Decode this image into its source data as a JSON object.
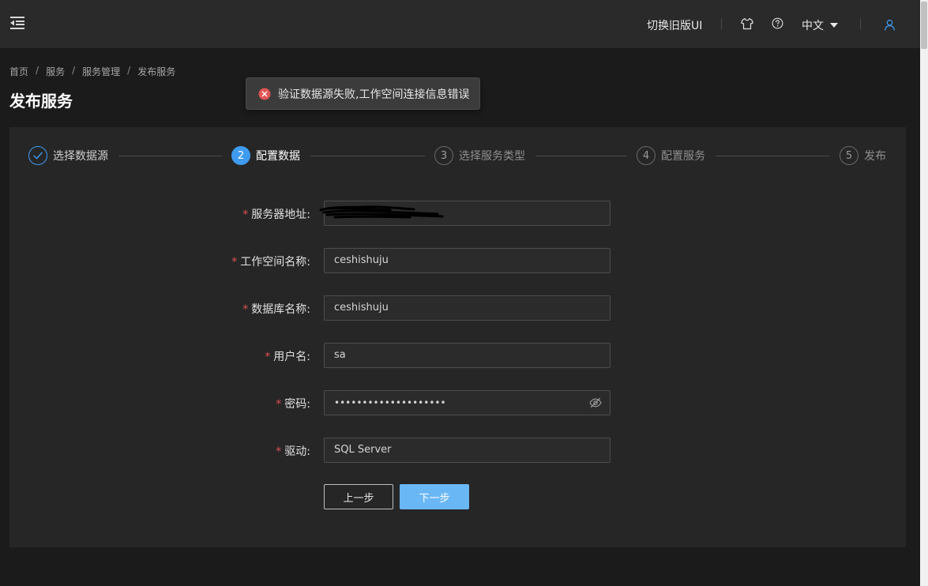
{
  "header": {
    "switch_ui_label": "切换旧版UI",
    "language_label": "中文",
    "icons": [
      "menu-fold-icon",
      "tshirt-icon",
      "help-icon",
      "user-icon"
    ]
  },
  "breadcrumb": {
    "items": [
      "首页",
      "服务",
      "服务管理",
      "发布服务"
    ],
    "separator": "/"
  },
  "page_title": "发布服务",
  "toast": {
    "type": "error",
    "message": "验证数据源失败,工作空间连接信息错误",
    "icon": "error-circle-icon",
    "color": "#e15454"
  },
  "steps": [
    {
      "number": "1",
      "label": "选择数据源",
      "status": "done"
    },
    {
      "number": "2",
      "label": "配置数据",
      "status": "active"
    },
    {
      "number": "3",
      "label": "选择服务类型",
      "status": "wait"
    },
    {
      "number": "4",
      "label": "配置服务",
      "status": "wait"
    },
    {
      "number": "5",
      "label": "发布",
      "status": "wait"
    }
  ],
  "form": {
    "required_mark": "*",
    "fields": [
      {
        "label": "服务器地址:",
        "value": "",
        "redacted": true
      },
      {
        "label": "工作空间名称:",
        "value": "ceshishuju"
      },
      {
        "label": "数据库名称:",
        "value": "ceshishuju"
      },
      {
        "label": "用户名:",
        "value": "sa"
      },
      {
        "label": "密码:",
        "value": "••••••••••••••••••••",
        "type": "password",
        "icon": "eye-off-icon"
      },
      {
        "label": "驱动:",
        "value": "SQL Server"
      }
    ]
  },
  "buttons": {
    "prev_label": "上一步",
    "next_label": "下一步"
  },
  "colors": {
    "accent": "#3f9bf0",
    "next_button": "#6ab7f5",
    "error": "#e15454",
    "required": "#e05050"
  }
}
